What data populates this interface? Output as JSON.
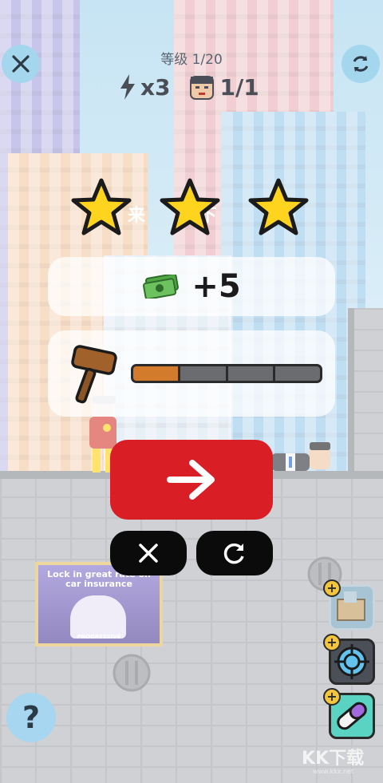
{
  "header": {
    "level": "等级 1/20",
    "energy": "x3",
    "targets": "1/1"
  },
  "result": {
    "stars_earned": 3,
    "stars_total": 3,
    "partial_text": "来  下",
    "reward": "+5",
    "hammer_progress_segments_filled": 1,
    "hammer_progress_segments_total": 4
  },
  "poster": {
    "headline": "Lock in great rate on car insurance",
    "brand": "PROGRESSIVE"
  },
  "watermark": {
    "main": "KK下载",
    "sub": "www.kkx.net"
  },
  "help": {
    "label": "?"
  },
  "colors": {
    "primary_button": "#d91e26",
    "secondary_button": "#0b0b0b",
    "star": "#ffd41e",
    "progress_fill": "#d37b2c",
    "round_button": "#a4d6ee"
  },
  "icons": {
    "close": "close-icon",
    "restart": "restart-icon",
    "energy": "lightning-icon",
    "target": "thug-face-icon",
    "money": "money-icon",
    "hammer": "hammer-icon",
    "next": "arrow-right-icon",
    "powerups": [
      "box-powerup-icon",
      "crosshair-powerup-icon",
      "pill-powerup-icon"
    ]
  }
}
